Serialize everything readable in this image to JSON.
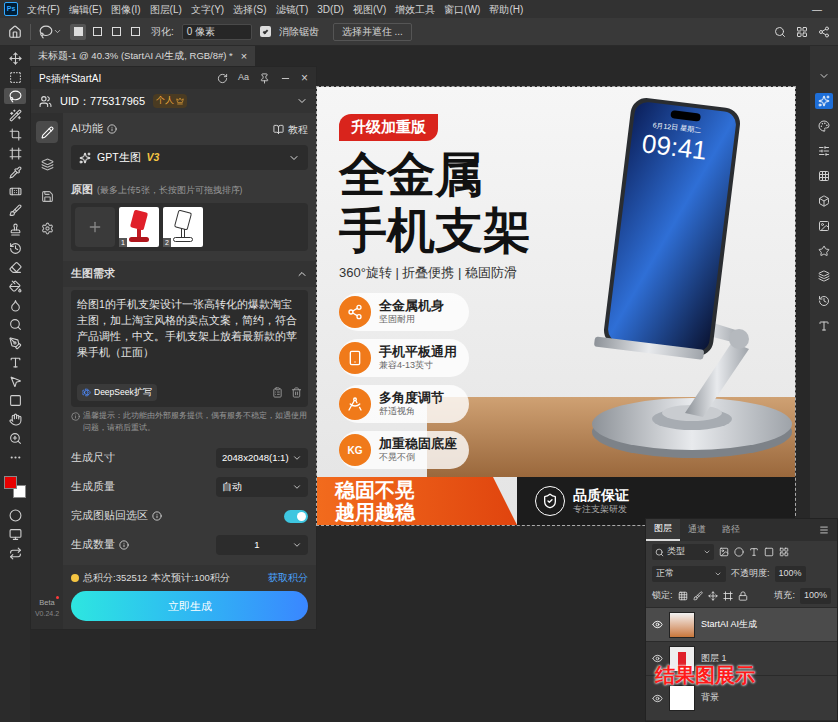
{
  "menu": {
    "logo": "Ps",
    "items": [
      "文件(F)",
      "编辑(E)",
      "图像(I)",
      "图层(L)",
      "文字(Y)",
      "选择(S)",
      "滤镜(T)",
      "3D(D)",
      "视图(V)",
      "增效工具",
      "窗口(W)",
      "帮助(H)"
    ],
    "window_controls": [
      "—"
    ]
  },
  "options_bar": {
    "modes": [
      {
        "selected": true
      },
      {
        "selected": false
      },
      {
        "selected": false
      },
      {
        "selected": false
      }
    ],
    "feather_label": "羽化:",
    "feather_value": "0 像素",
    "antialias": {
      "label": "消除锯齿",
      "checked": true
    },
    "button": "选择并遮住 ..."
  },
  "tools": [
    {
      "selected": false
    },
    {
      "selected": false
    },
    {
      "selected": true
    },
    {
      "selected": false
    },
    {
      "selected": false
    },
    {
      "selected": false
    },
    {
      "selected": false
    },
    {
      "selected": false
    },
    {
      "selected": false
    },
    {
      "selected": false
    },
    {
      "selected": false
    },
    {
      "selected": false
    },
    {
      "selected": false
    },
    {
      "selected": false
    },
    {
      "selected": false
    },
    {
      "selected": false
    },
    {
      "selected": false
    },
    {
      "selected": false
    },
    {
      "selected": false
    },
    {
      "selected": false
    },
    {
      "selected": false
    },
    {
      "selected": false
    }
  ],
  "colors": {
    "foreground": "#e60000",
    "background": "#ffffff"
  },
  "document_tab": {
    "title": "未标题-1 @ 40.3% (StartAI AI生成, RGB/8#) *",
    "close": "×"
  },
  "plugin": {
    "title": "Ps插件StartAI",
    "font_button": "Aa",
    "close": "×",
    "uid": "UID：775317965",
    "plan": "个人",
    "nav": [
      {
        "selected": true
      },
      {
        "selected": false
      },
      {
        "selected": false
      },
      {
        "selected": false
      }
    ],
    "ai_label": "AI功能",
    "tutorial": "教程",
    "model": {
      "name": "GPT生图",
      "version": "V3"
    },
    "source": {
      "label": "原图",
      "hint": "(最多上传5张，长按图片可拖拽排序)",
      "images": [
        {
          "index": "1"
        },
        {
          "index": "2"
        }
      ]
    },
    "prompt": {
      "label": "生图需求",
      "expanded": true,
      "text": "给图1的手机支架设计一张高转化的爆款淘宝主图，加上淘宝风格的卖点文案，简约，符合产品调性，中文。手机支架上放着最新款的苹果手机（正面）",
      "expand_button": "DeepSeek扩写"
    },
    "notice": "温馨提示：此功能由外部服务提供，偶有服务不稳定，如遇使用问题，请稍后重试。",
    "settings": [
      {
        "kind": "select",
        "label": "生成尺寸",
        "value": "2048x2048(1:1)",
        "info": false
      },
      {
        "kind": "select",
        "label": "生成质量",
        "value": "自动",
        "info": false
      },
      {
        "kind": "toggle",
        "label": "完成图贴回选区",
        "on": true,
        "info": true
      },
      {
        "kind": "stepper",
        "label": "生成数量",
        "value": "1",
        "info": true
      }
    ],
    "points": {
      "total": "总积分:352512",
      "estimate": "本次预计:100积分",
      "get": "获取积分"
    },
    "generate": "立即生成",
    "beta": "Beta",
    "version": "V0.24.2"
  },
  "canvas": {
    "badge": "升级加重版",
    "title": [
      "全金属",
      "手机支架"
    ],
    "subtitle": "360°旋转 | 折叠便携 | 稳固防滑",
    "features": [
      {
        "title": "全金属机身",
        "sub": "坚固耐用"
      },
      {
        "title": "手机平板通用",
        "sub": "兼容4-13英寸"
      },
      {
        "title": "多角度调节",
        "sub": "舒适视角"
      },
      {
        "title": "加重稳固底座",
        "sub": "不晃不倒",
        "mark": "KG"
      }
    ],
    "phone": {
      "date": "6月12日 星期二",
      "time": "09:41"
    },
    "slogan": [
      "稳固不晃",
      "越用越稳"
    ],
    "guarantee": {
      "title": "品质保证",
      "sub": "专注支架研发"
    }
  },
  "layers_panel": {
    "tabs": [
      {
        "label": "图层",
        "selected": true
      },
      {
        "label": "通道",
        "selected": false
      },
      {
        "label": "路径",
        "selected": false
      }
    ],
    "filter": "类型",
    "blend": "正常",
    "opacity_label": "不透明度:",
    "opacity": "100%",
    "lock_label": "锁定:",
    "fill_label": "填充:",
    "fill": "100%",
    "layers": [
      {
        "name": "StartAI AI生成",
        "selected": true,
        "visible": true
      },
      {
        "name": "图层 1",
        "selected": false,
        "visible": true
      },
      {
        "name": "背景",
        "selected": false,
        "visible": true
      }
    ]
  },
  "caption": "结果图展示"
}
